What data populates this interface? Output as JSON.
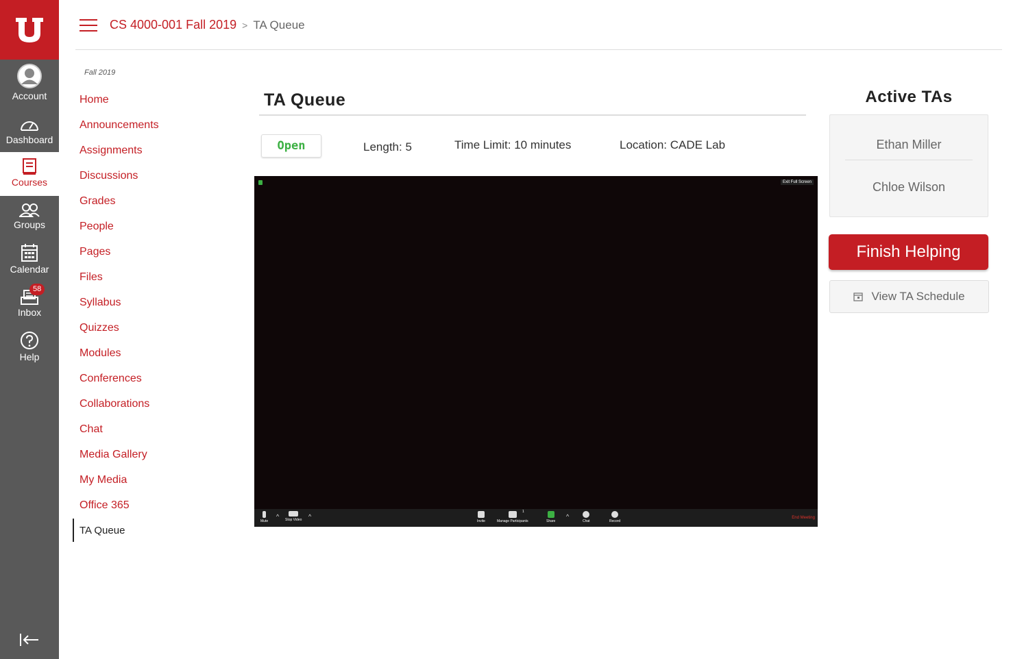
{
  "global_nav": {
    "items": [
      {
        "label": "Account",
        "icon": "account-icon"
      },
      {
        "label": "Dashboard",
        "icon": "dashboard-icon"
      },
      {
        "label": "Courses",
        "icon": "courses-icon",
        "active": true
      },
      {
        "label": "Groups",
        "icon": "groups-icon"
      },
      {
        "label": "Calendar",
        "icon": "calendar-icon"
      },
      {
        "label": "Inbox",
        "icon": "inbox-icon",
        "badge": "58"
      },
      {
        "label": "Help",
        "icon": "help-icon"
      }
    ]
  },
  "header": {
    "course": "CS 4000-001 Fall 2019",
    "separator": ">",
    "current": "TA Queue"
  },
  "course_nav": {
    "term": "Fall 2019",
    "items": [
      "Home",
      "Announcements",
      "Assignments",
      "Discussions",
      "Grades",
      "People",
      "Pages",
      "Files",
      "Syllabus",
      "Quizzes",
      "Modules",
      "Conferences",
      "Collaborations",
      "Chat",
      "Media Gallery",
      "My Media",
      "Office 365",
      "TA Queue"
    ],
    "active": "TA Queue"
  },
  "main": {
    "title": "TA Queue",
    "status": "Open",
    "length": "Length: 5",
    "time_limit": "Time Limit: 10 minutes",
    "location": "Location: CADE Lab"
  },
  "video": {
    "exit_full_screen": "Exit Full Screen",
    "toolbar": {
      "mute": "Mute",
      "stop_video": "Stop Video",
      "invite": "Invite",
      "manage_participants": "Manage Participants",
      "participants_count": "1",
      "share": "Share",
      "chat": "Chat",
      "record": "Record",
      "end_meeting": "End Meeting"
    }
  },
  "sidebar_right": {
    "title": "Active TAs",
    "tas": [
      "Ethan Miller",
      "Chloe Wilson"
    ],
    "finish_label": "Finish Helping",
    "schedule_label": "View TA Schedule"
  },
  "colors": {
    "brand_red": "#c41e24",
    "nav_gray": "#595959",
    "open_green": "#3cb043"
  }
}
